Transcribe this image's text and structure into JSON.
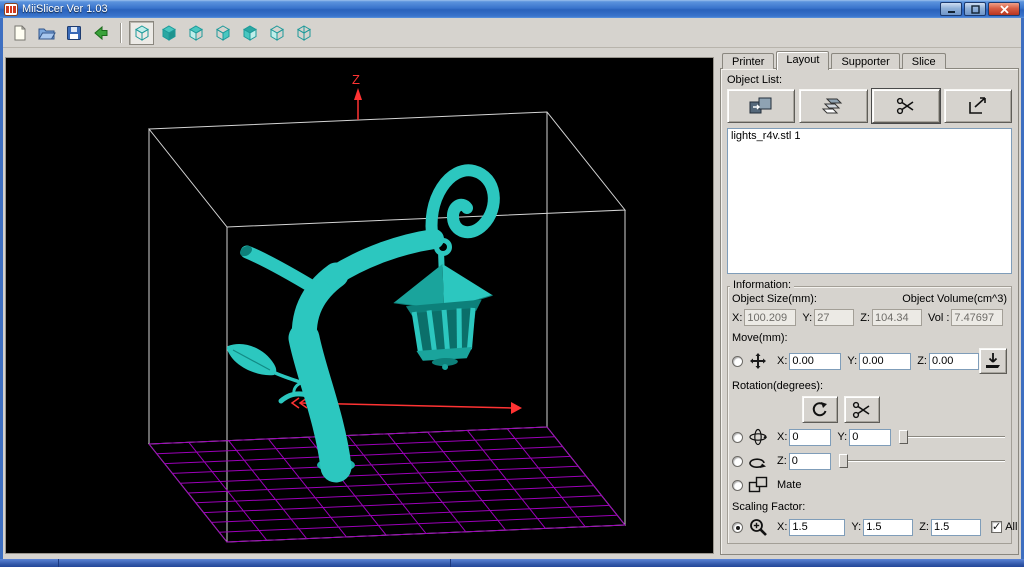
{
  "window": {
    "title": "MiiSlicer Ver 1.03"
  },
  "tabs": {
    "printer": "Printer",
    "layout": "Layout",
    "supporter": "Supporter",
    "slice": "Slice",
    "active_tab": "Layout"
  },
  "object_list": {
    "label": "Object List:",
    "items": [
      {
        "name": "lights_r4v.stl 1"
      }
    ]
  },
  "information": {
    "label": "Information:",
    "object_size_label": "Object Size(mm):",
    "object_volume_label": "Object Volume(cm^3)",
    "size_x_label": "X:",
    "size_x": "100.209",
    "size_y_label": "Y:",
    "size_y": "27",
    "size_z_label": "Z:",
    "size_z": "104.34",
    "vol_label": "Vol :",
    "vol": "7.47697",
    "move_label": "Move(mm):",
    "move_x_label": "X:",
    "move_x": "0.00",
    "move_y_label": "Y:",
    "move_y": "0.00",
    "move_z_label": "Z:",
    "move_z": "0.00",
    "rotation_label": "Rotation(degrees):",
    "rot_x_label": "X:",
    "rot_x": "0",
    "rot_y_label": "Y:",
    "rot_y": "0",
    "rot_z_label": "Z:",
    "rot_z": "0",
    "mate_label": "Mate",
    "scaling_label": "Scaling Factor:",
    "scale_x_label": "X:",
    "scale_x": "1.5",
    "scale_y_label": "Y:",
    "scale_y": "1.5",
    "scale_z_label": "Z:",
    "scale_z": "1.5",
    "all_label": "All",
    "all_checked": true,
    "scaling_selected": true
  },
  "viewport": {
    "z_axis_label": "Z"
  },
  "colors": {
    "model_teal": "#2cc7bf",
    "grid_purple": "#9b00b8",
    "axis_red": "#ff3333",
    "wireframe_gray": "#d4d4d4",
    "titlebar_blue": "#3a74cc",
    "taskbar_blue": "#3a66c0",
    "panel_gray": "#d6d3ce"
  },
  "icons": {
    "toolbar": [
      "new-document-icon",
      "open-folder-icon",
      "save-icon",
      "back-arrow-icon",
      "view-cube-icon x7"
    ],
    "object_buttons": [
      "add-object-icon",
      "copy-object-icon",
      "scissors-icon",
      "export-icon"
    ],
    "panel": [
      "move-arrows-icon",
      "drop-to-bed-icon",
      "rotate-arc-icon",
      "scissors-icon",
      "rotate-3d-icon",
      "rotate-z-icon",
      "mate-icon",
      "magnifier-icon"
    ]
  }
}
